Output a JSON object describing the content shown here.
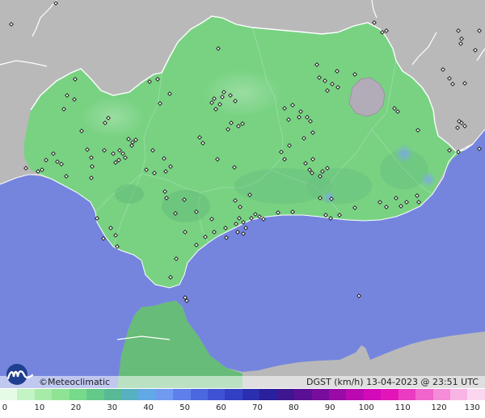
{
  "credit": "©Meteoclimatic",
  "title": {
    "variable": "DGST",
    "units": "(km/h)",
    "datetime": "13-04-2023 @ 23:51 UTC"
  },
  "legend": {
    "ticks": [
      "0",
      "10",
      "20",
      "30",
      "40",
      "50",
      "60",
      "70",
      "80",
      "90",
      "100",
      "110",
      "120",
      "130"
    ],
    "colors": [
      "#e6fbe6",
      "#c4f3c4",
      "#a7eba8",
      "#8fe394",
      "#77d98a",
      "#62c98a",
      "#57ba95",
      "#56b0c0",
      "#60a8e6",
      "#6f9af0",
      "#5f80ea",
      "#4d67e0",
      "#3f52d4",
      "#3240c4",
      "#2a2fb0",
      "#2a1f9c",
      "#3e1790",
      "#5a1094",
      "#780c9c",
      "#9a0aa6",
      "#b80ab0",
      "#d20ab8",
      "#e216b8",
      "#ea3cc2",
      "#f064cc",
      "#f48cd8",
      "#f8b4e4",
      "#fbd6f0"
    ]
  },
  "colors": {
    "sea": "#7585de",
    "land": "#b9b9b9",
    "region": "#78d282",
    "africa": "#66bc78"
  },
  "stations": [
    [
      14,
      30
    ],
    [
      69,
      4
    ],
    [
      93,
      98
    ],
    [
      83,
      118
    ],
    [
      92,
      123
    ],
    [
      79,
      135
    ],
    [
      134,
      146
    ],
    [
      130,
      152
    ],
    [
      101,
      162
    ],
    [
      108,
      185
    ],
    [
      113,
      195
    ],
    [
      114,
      206
    ],
    [
      113,
      220
    ],
    [
      76,
      203
    ],
    [
      66,
      190
    ],
    [
      71,
      200
    ],
    [
      57,
      198
    ],
    [
      52,
      210
    ],
    [
      47,
      212
    ],
    [
      82,
      218
    ],
    [
      32,
      208
    ],
    [
      129,
      186
    ],
    [
      140,
      190
    ],
    [
      148,
      186
    ],
    [
      152,
      190
    ],
    [
      155,
      195
    ],
    [
      147,
      198
    ],
    [
      163,
      180
    ],
    [
      164,
      176
    ],
    [
      159,
      172
    ],
    [
      168,
      173
    ],
    [
      143,
      201
    ],
    [
      189,
      186
    ],
    [
      181,
      210
    ],
    [
      203,
      196
    ],
    [
      211,
      206
    ],
    [
      205,
      212
    ],
    [
      191,
      214
    ],
    [
      185,
      101
    ],
    [
      195,
      98
    ],
    [
      210,
      116
    ],
    [
      198,
      128
    ],
    [
      275,
      120
    ],
    [
      277,
      114
    ],
    [
      272,
      129
    ],
    [
      265,
      122
    ],
    [
      285,
      118
    ],
    [
      291,
      125
    ],
    [
      262,
      127
    ],
    [
      267,
      135
    ],
    [
      270,
      60
    ],
    [
      247,
      170
    ],
    [
      251,
      177
    ],
    [
      269,
      197
    ],
    [
      286,
      152
    ],
    [
      295,
      156
    ],
    [
      282,
      160
    ],
    [
      300,
      153
    ],
    [
      290,
      207
    ],
    [
      352,
      134
    ],
    [
      362,
      130
    ],
    [
      372,
      138
    ],
    [
      370,
      145
    ],
    [
      357,
      148
    ],
    [
      380,
      145
    ],
    [
      384,
      150
    ],
    [
      387,
      164
    ],
    [
      376,
      171
    ],
    [
      387,
      197
    ],
    [
      378,
      202
    ],
    [
      383,
      210
    ],
    [
      386,
      214
    ],
    [
      399,
      212
    ],
    [
      396,
      218
    ],
    [
      405,
      208
    ],
    [
      352,
      197
    ],
    [
      392,
      80
    ],
    [
      395,
      96
    ],
    [
      402,
      100
    ],
    [
      411,
      104
    ],
    [
      405,
      112
    ],
    [
      418,
      108
    ],
    [
      417,
      88
    ],
    [
      439,
      92
    ],
    [
      488,
      134
    ],
    [
      492,
      138
    ],
    [
      517,
      161
    ],
    [
      358,
      180
    ],
    [
      348,
      188
    ],
    [
      396,
      245
    ],
    [
      410,
      246
    ],
    [
      204,
      237
    ],
    [
      206,
      245
    ],
    [
      217,
      264
    ],
    [
      228,
      247
    ],
    [
      243,
      262
    ],
    [
      229,
      287
    ],
    [
      243,
      303
    ],
    [
      218,
      320
    ],
    [
      262,
      271
    ],
    [
      265,
      287
    ],
    [
      279,
      282
    ],
    [
      292,
      277
    ],
    [
      296,
      270
    ],
    [
      301,
      275
    ],
    [
      304,
      282
    ],
    [
      311,
      270
    ],
    [
      316,
      265
    ],
    [
      321,
      268
    ],
    [
      326,
      271
    ],
    [
      291,
      248
    ],
    [
      297,
      256
    ],
    [
      309,
      241
    ],
    [
      301,
      289
    ],
    [
      294,
      287
    ],
    [
      280,
      294
    ],
    [
      254,
      293
    ],
    [
      344,
      263
    ],
    [
      362,
      262
    ],
    [
      403,
      266
    ],
    [
      409,
      270
    ],
    [
      420,
      266
    ],
    [
      439,
      257
    ],
    [
      470,
      250
    ],
    [
      478,
      256
    ],
    [
      490,
      245
    ],
    [
      496,
      255
    ],
    [
      503,
      250
    ],
    [
      518,
      250
    ],
    [
      516,
      242
    ],
    [
      137,
      282
    ],
    [
      145,
      305
    ],
    [
      128,
      295
    ],
    [
      120,
      270
    ],
    [
      143,
      291
    ],
    [
      211,
      343
    ],
    [
      229,
      368
    ],
    [
      231,
      372
    ],
    [
      463,
      28
    ],
    [
      478,
      38
    ],
    [
      473,
      40
    ],
    [
      548,
      86
    ],
    [
      567,
      38
    ],
    [
      571,
      48
    ],
    [
      570,
      54
    ],
    [
      588,
      62
    ],
    [
      593,
      38
    ],
    [
      556,
      97
    ],
    [
      560,
      104
    ],
    [
      575,
      103
    ],
    [
      568,
      150
    ],
    [
      575,
      156
    ],
    [
      571,
      152
    ],
    [
      566,
      158
    ],
    [
      556,
      186
    ],
    [
      567,
      188
    ],
    [
      593,
      184
    ],
    [
      444,
      366
    ]
  ]
}
